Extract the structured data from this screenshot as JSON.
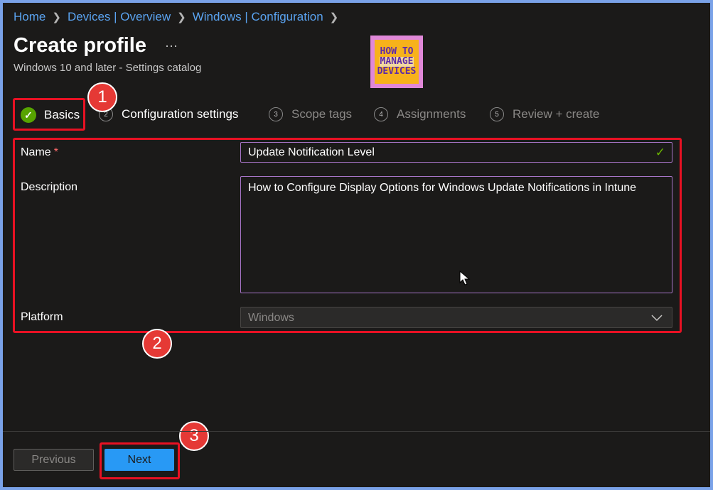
{
  "breadcrumb": [
    "Home",
    "Devices | Overview",
    "Windows | Configuration"
  ],
  "page": {
    "title": "Create profile",
    "more_label": "···",
    "subtitle": "Windows 10 and later - Settings catalog"
  },
  "logo": {
    "line1": "HOW TO",
    "line2": "MANAGE",
    "line3": "DEVICES"
  },
  "steps": [
    {
      "label": "Basics",
      "state": "complete"
    },
    {
      "num": "2",
      "label": "Configuration settings",
      "state": "current"
    },
    {
      "num": "3",
      "label": "Scope tags",
      "state": "disabled"
    },
    {
      "num": "4",
      "label": "Assignments",
      "state": "disabled"
    },
    {
      "num": "5",
      "label": "Review + create",
      "state": "disabled"
    }
  ],
  "form": {
    "name_label": "Name",
    "required_mark": "*",
    "name_value": "Update Notification Level",
    "description_label": "Description",
    "description_value": "How to Configure Display Options for Windows Update Notifications in Intune",
    "platform_label": "Platform",
    "platform_value": "Windows"
  },
  "annotations": [
    "1",
    "2",
    "3"
  ],
  "footer": {
    "previous_label": "Previous",
    "next_label": "Next"
  },
  "colors": {
    "accent": "#2899f5",
    "success": "#57a300",
    "highlight": "#e81123",
    "frame": "#7aa2e8"
  }
}
